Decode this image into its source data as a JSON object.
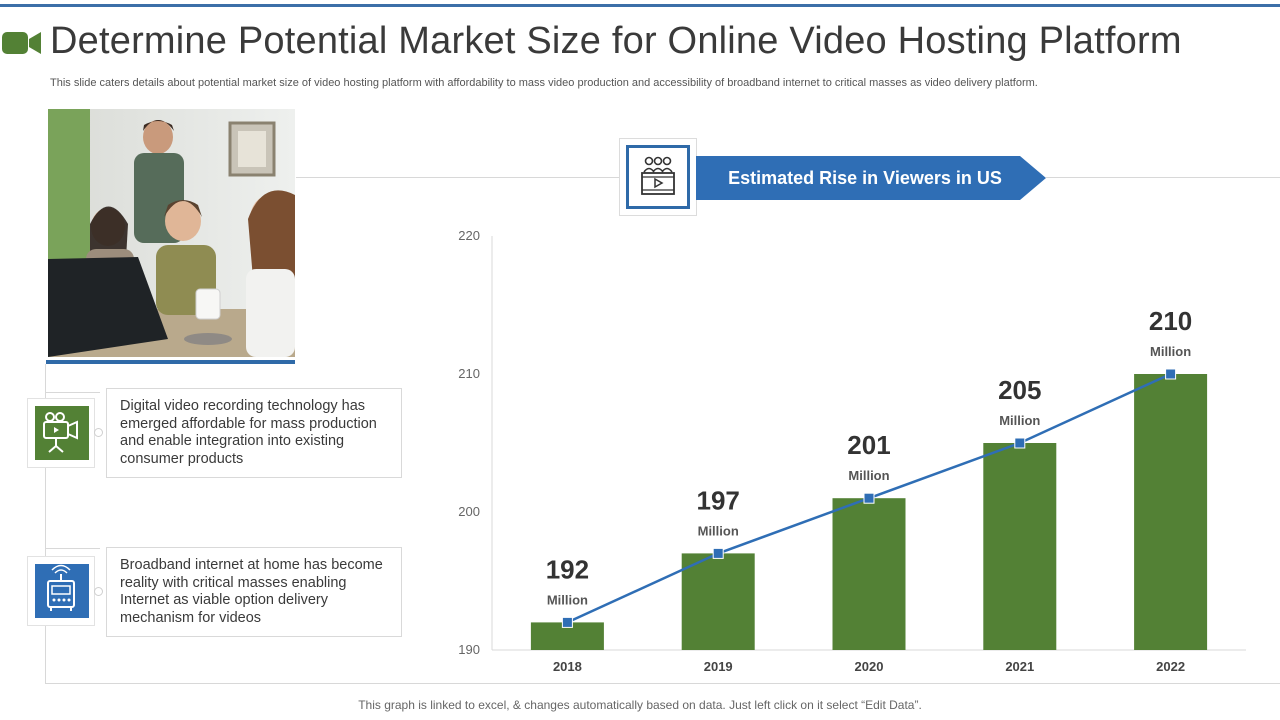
{
  "slide": {
    "title": "Determine Potential Market Size for Online Video Hosting Platform",
    "subtitle": "This slide caters details about potential market size of video hosting platform with affordability to mass video production and accessibility of broadband internet to critical masses as video delivery platform.",
    "title_icon": "video-camera-icon",
    "photo": "team-at-laptop-photo",
    "footnote": "This graph is linked to excel, & changes automatically based on data. Just left click on it select “Edit Data”."
  },
  "points": [
    {
      "icon": "camcorder-icon",
      "color": "#538135",
      "text": "Digital video recording technology has emerged affordable for mass production and enable integration into existing consumer products"
    },
    {
      "icon": "router-icon",
      "color": "#2f6eb5",
      "text": "Broadband internet at home has become reality with critical masses enabling Internet as viable option delivery mechanism for videos"
    }
  ],
  "banner": {
    "label": "Estimated Rise in Viewers in US",
    "icon": "audience-video-icon",
    "color": "#2f6eb5"
  },
  "chart_data": {
    "type": "bar",
    "categories": [
      "2018",
      "2019",
      "2020",
      "2021",
      "2022"
    ],
    "series": [
      {
        "type": "bar",
        "values": [
          192,
          197,
          201,
          205,
          210
        ],
        "color": "#538135"
      },
      {
        "type": "line",
        "values": [
          192,
          197,
          201,
          205,
          210
        ],
        "color": "#2f6eb5",
        "marker": "square"
      }
    ],
    "data_labels": [
      "192",
      "197",
      "201",
      "205",
      "210"
    ],
    "unit_label": "Million",
    "yticks": [
      190,
      200,
      210,
      220
    ],
    "ylim": [
      190,
      220
    ],
    "grid": false,
    "legend": "none"
  }
}
